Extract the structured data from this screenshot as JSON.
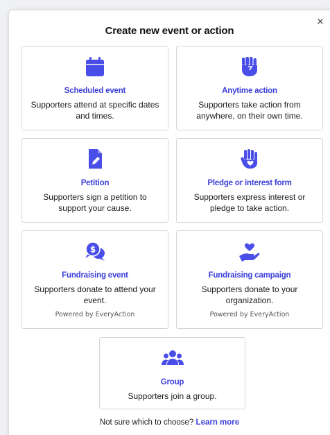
{
  "modal": {
    "title": "Create new event or action",
    "close_icon": "×"
  },
  "accent_color": "#4a4ee8",
  "cards": [
    {
      "name": "Scheduled event",
      "desc": "Supporters attend at specific dates and times.",
      "icon": "calendar-icon"
    },
    {
      "name": "Anytime action",
      "desc": "Supporters take action from anywhere, on their own time.",
      "icon": "raised-fist-icon"
    },
    {
      "name": "Petition",
      "desc": "Supporters sign a petition to support your cause.",
      "icon": "document-pen-icon"
    },
    {
      "name": "Pledge or interest form",
      "desc": "Supporters express interest or pledge to take action.",
      "icon": "hand-heart-icon"
    },
    {
      "name": "Fundraising event",
      "desc": "Supporters donate to attend your event.",
      "sub": "Powered by EveryAction",
      "icon": "dollar-chat-icon"
    },
    {
      "name": "Fundraising campaign",
      "desc": "Supporters donate to your organization.",
      "sub": "Powered by EveryAction",
      "icon": "heart-hand-icon"
    },
    {
      "name": "Group",
      "desc": "Supporters join a group.",
      "icon": "group-icon"
    }
  ],
  "footer": {
    "text": "Not sure which to choose?",
    "link": "Learn more"
  }
}
